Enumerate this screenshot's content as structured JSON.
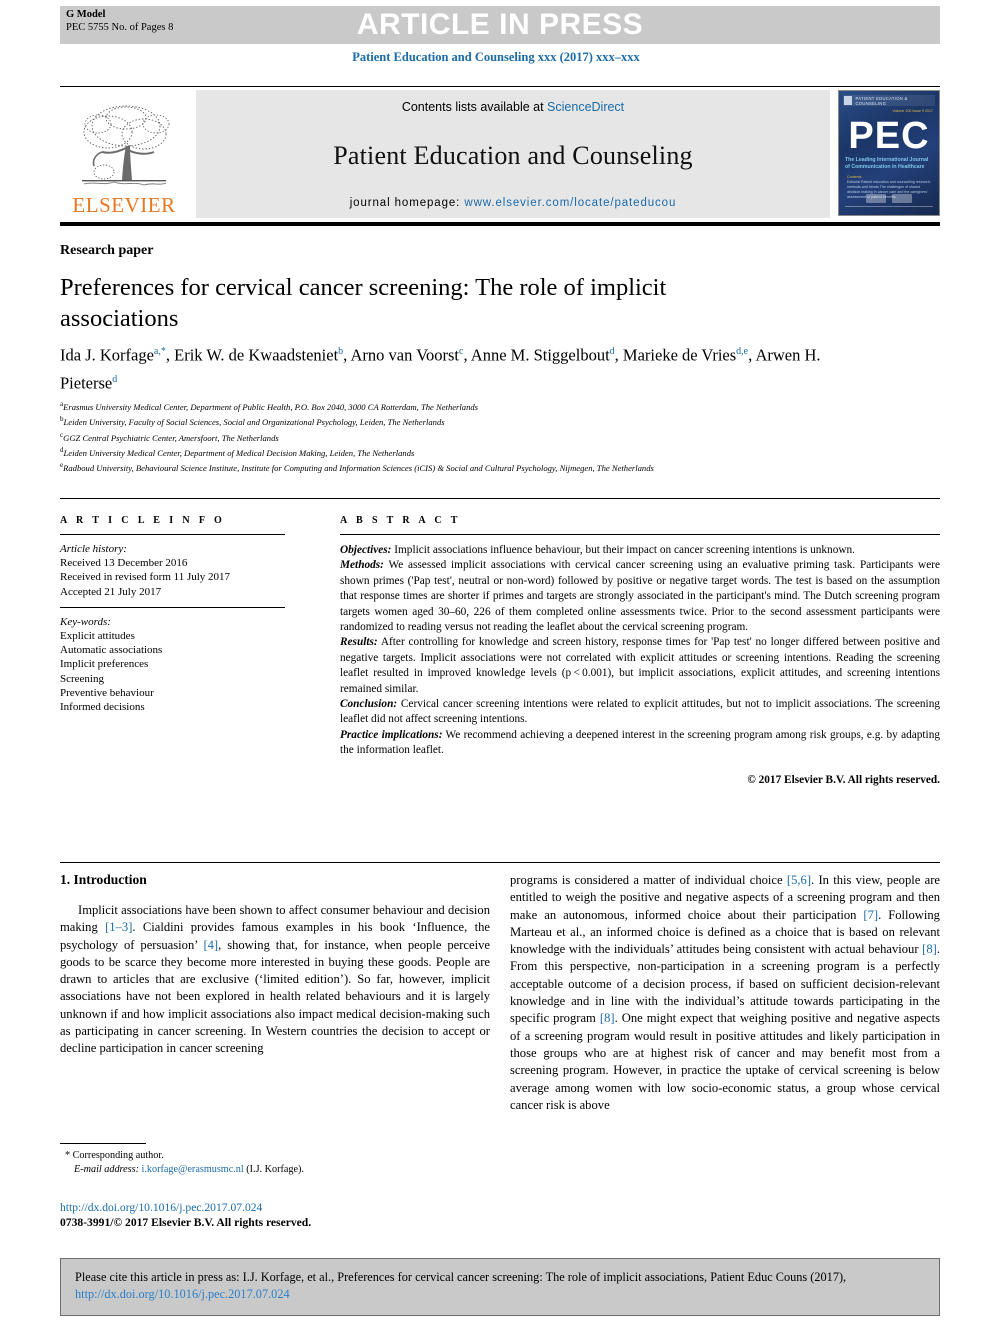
{
  "header": {
    "g_model": "G Model",
    "manuscript_id": "PEC 5755 No. of Pages 8",
    "press_banner": "ARTICLE IN PRESS",
    "running_head": "Patient Education and Counseling xxx (2017) xxx–xxx"
  },
  "masthead": {
    "publisher": "ELSEVIER",
    "contents_prefix": "Contents lists available at ",
    "contents_link": "ScienceDirect",
    "journal_name": "Patient Education and Counseling",
    "homepage_prefix": "journal homepage: ",
    "homepage_url": "www.elsevier.com/locate/pateducou",
    "cover": {
      "acronym": "PEC",
      "top_title": "PATIENT EDUCATION & COUNSELING",
      "issue_line": "Volume 100\nIssue 9  2017",
      "tagline": "The Leading International Journal\nof Communication in Healthcare",
      "list_header": "Contents",
      "list_lines": "Editorial\nPatient education and counselling research:\nmethods and trends\nThe challenges of shared decision making\nin cancer care and the caregivers' assessment\nof patient benefits"
    }
  },
  "article": {
    "kind": "Research paper",
    "title": "Preferences for cervical cancer screening: The role of implicit associations",
    "authors": [
      {
        "name": "Ida J. Korfage",
        "sup": "a,*"
      },
      {
        "name": "Erik W. de Kwaadsteniet",
        "sup": "b"
      },
      {
        "name": "Arno van Voorst",
        "sup": "c"
      },
      {
        "name": "Anne M. Stiggelbout",
        "sup": "d"
      },
      {
        "name": "Marieke de Vries",
        "sup": "d,e"
      },
      {
        "name": "Arwen H. Pieterse",
        "sup": "d"
      }
    ],
    "affiliations": [
      {
        "sup": "a",
        "text": "Erasmus University Medical Center, Department of Public Health, P.O. Box 2040, 3000 CA Rotterdam, The Netherlands"
      },
      {
        "sup": "b",
        "text": "Leiden University, Faculty of Social Sciences, Social and Organizational Psychology, Leiden, The Netherlands"
      },
      {
        "sup": "c",
        "text": "GGZ Central Psychiatric Center, Amersfoort, The Netherlands"
      },
      {
        "sup": "d",
        "text": "Leiden University Medical Center, Department of Medical Decision Making, Leiden, The Netherlands"
      },
      {
        "sup": "e",
        "text": "Radboud University, Behavioural Science Institute, Institute for Computing and Information Sciences (iCIS) & Social and Cultural Psychology, Nijmegen, The Netherlands"
      }
    ]
  },
  "article_info": {
    "heading": "A R T I C L E   I N F O",
    "history_label": "Article history:",
    "history": [
      "Received 13 December 2016",
      "Received in revised form 11 July 2017",
      "Accepted 21 July 2017"
    ],
    "keywords_label": "Key-words:",
    "keywords": [
      "Explicit attitudes",
      "Automatic associations",
      "Implicit preferences",
      "Screening",
      "Preventive behaviour",
      "Informed decisions"
    ]
  },
  "abstract": {
    "heading": "A B S T R A C T",
    "sections": [
      {
        "label": "Objectives:",
        "text": " Implicit associations influence behaviour, but their impact on cancer screening intentions is unknown."
      },
      {
        "label": "Methods:",
        "text": " We assessed implicit associations with cervical cancer screening using an evaluative priming task. Participants were shown primes ('Pap test', neutral or non-word) followed by positive or negative target words. The test is based on the assumption that response times are shorter if primes and targets are strongly associated in the participant's mind. The Dutch screening program targets women aged 30–60, 226 of them completed online assessments twice. Prior to the second assessment participants were randomized to reading versus not reading the leaflet about the cervical screening program."
      },
      {
        "label": "Results:",
        "text": " After controlling for knowledge and screen history, response times for 'Pap test' no longer differed between positive and negative targets. Implicit associations were not correlated with explicit attitudes or screening intentions. Reading the screening leaflet resulted in improved knowledge levels (p < 0.001), but implicit associations, explicit attitudes, and screening intentions remained similar."
      },
      {
        "label": "Conclusion:",
        "text": " Cervical cancer screening intentions were related to explicit attitudes, but not to implicit associations. The screening leaflet did not affect screening intentions."
      },
      {
        "label": "Practice implications:",
        "text": " We recommend achieving a deepened interest in the screening program among risk groups, e.g. by adapting the information leaflet."
      }
    ],
    "rights": "© 2017 Elsevier B.V. All rights reserved."
  },
  "body": {
    "section_heading": "1. Introduction",
    "left_paragraphs": [
      "Implicit associations have been shown to affect consumer behaviour and decision making [1–3]. Cialdini provides famous examples in his book 'Influence, the psychology of persuasion' [4], showing that, for instance, when people perceive goods to be scarce they become more interested in buying these goods. People are drawn to articles that are exclusive ('limited edition'). So far, however, implicit associations have not been explored in health related behaviours and it is largely unknown if and how implicit associations also impact medical decision-making such as participating in cancer screening. In Western countries the decision to accept or decline participation in cancer screening"
    ],
    "right_paragraphs": [
      "programs is considered a matter of individual choice [5,6]. In this view, people are entitled to weigh the positive and negative aspects of a screening program and then make an autonomous, informed choice about their participation [7]. Following Marteau et al., an informed choice is defined as a choice that is based on relevant knowledge with the individuals' attitudes being consistent with actual behaviour [8]. From this perspective, non-participation in a screening program is a perfectly acceptable outcome of a decision process, if based on sufficient decision-relevant knowledge and in line with the individual's attitude towards participating in the specific program [8]. One might expect that weighing positive and negative aspects of a screening program would result in positive attitudes and likely participation in those groups who are at highest risk of cancer and may benefit most from a screening program. However, in practice the uptake of cervical screening is below average among women with low socio-economic status, a group whose cervical cancer risk is above"
    ]
  },
  "footnote": {
    "corresponding_marker": "*",
    "corresponding_text": "Corresponding author.",
    "email_label": "E-mail address:",
    "email": "i.korfage@erasmusmc.nl",
    "email_owner": "(I.J. Korfage).",
    "doi_url": "http://dx.doi.org/10.1016/j.pec.2017.07.024",
    "issn_line": "0738-3991/© 2017 Elsevier B.V. All rights reserved."
  },
  "cite_box": {
    "text": "Please cite this article in press as: I.J. Korfage, et al., Preferences for cervical cancer screening: The role of implicit associations, Patient Educ Couns (2017), ",
    "link": "http://dx.doi.org/10.1016/j.pec.2017.07.024"
  },
  "colors": {
    "link_blue": "#1a6ba8",
    "elsevier_orange": "#E87722",
    "banner_gray": "#c9c9c9",
    "masthead_gray": "#e6e6e6"
  }
}
